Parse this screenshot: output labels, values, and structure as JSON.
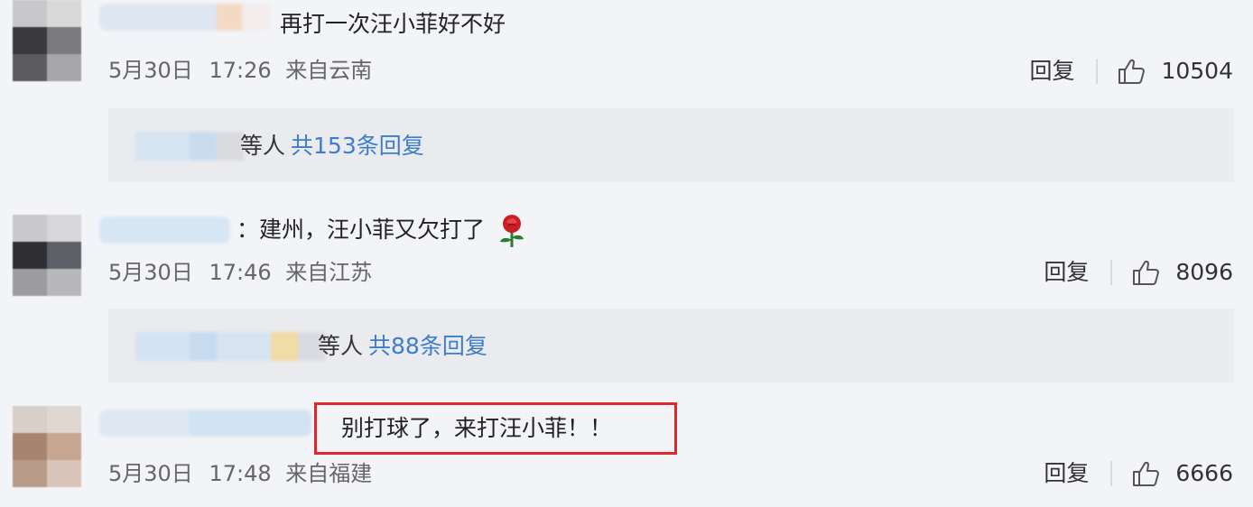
{
  "comments": [
    {
      "text": "再打一次汪小菲好不好",
      "date": "5月30日",
      "time": "17:26",
      "source": "来自云南",
      "reply_label": "回复",
      "likes": "10504",
      "replies_others": "等人",
      "replies_count": "共153条回复"
    },
    {
      "text": "：建州，汪小菲又欠打了",
      "emoji": "rose-icon",
      "date": "5月30日",
      "time": "17:46",
      "source": "来自江苏",
      "reply_label": "回复",
      "likes": "8096",
      "replies_others": "等人",
      "replies_count": "共88条回复"
    },
    {
      "text": "别打球了，来打汪小菲！！",
      "date": "5月30日",
      "time": "17:48",
      "source": "来自福建",
      "reply_label": "回复",
      "likes": "6666",
      "highlight_color": "#e0262b"
    }
  ],
  "colors": {
    "link": "#3d7dcb",
    "background": "#f3f4f8",
    "replies_background": "#eaebef"
  }
}
